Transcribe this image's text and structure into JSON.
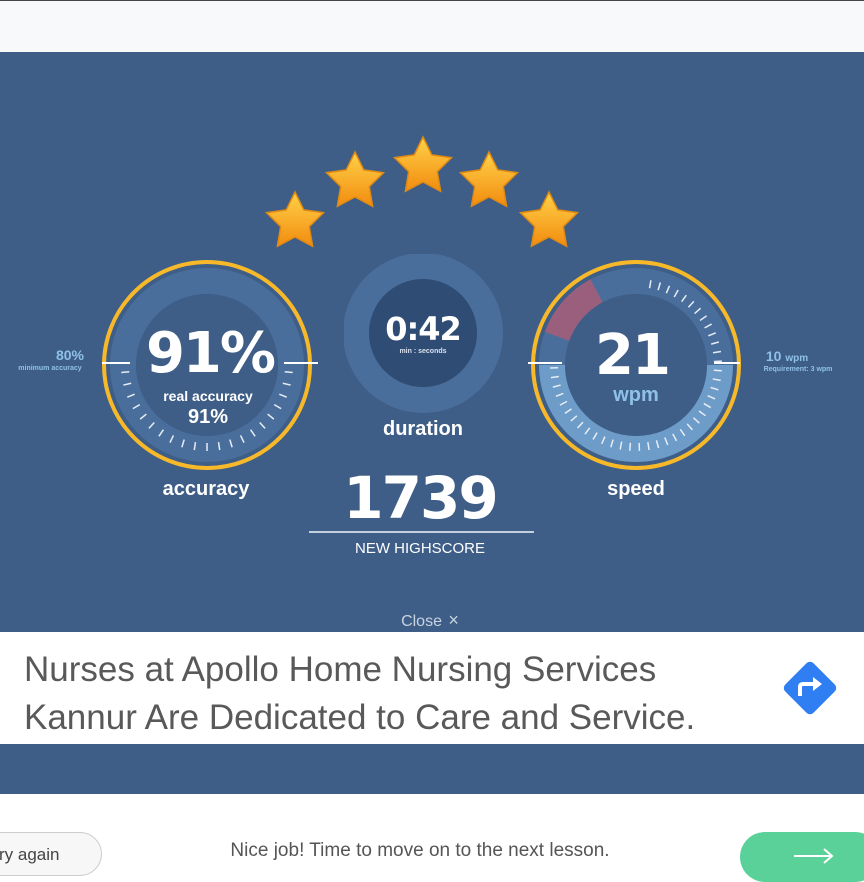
{
  "stats": {
    "stars_earned": 5,
    "stars_total": 5,
    "accuracy": {
      "percent_display": "91%",
      "percent_value": 91,
      "real_accuracy_label": "real accuracy",
      "real_accuracy_value": "91%",
      "label": "accuracy",
      "minimum_value": "80%",
      "minimum_label": "minimum accuracy"
    },
    "duration": {
      "value": "0:42",
      "unit_label": "min : seconds",
      "label": "duration"
    },
    "speed": {
      "value": "21",
      "unit": "wpm",
      "label": "speed",
      "requirement_value": "10",
      "requirement_unit": "wpm",
      "requirement_label": "Requirement: 3 wpm"
    },
    "score": {
      "value": "1739",
      "label": "NEW HIGHSCORE"
    }
  },
  "close_label": "Close",
  "close_icon": "×",
  "ad": {
    "text": "Nurses at Apollo Home Nursing Services Kannur Are Dedicated to Care and Service.",
    "icon": "directions-icon"
  },
  "footer": {
    "try_again_label": "ry again",
    "message": "Nice job! Time to move on to the next lesson.",
    "next_icon": "arrow-right-icon"
  },
  "colors": {
    "panel": "#3e5e87",
    "ring": "#f7b92a",
    "gauge_dark": "#2f4d74",
    "gauge_mid": "#4a6e9b",
    "speed_fill": "#6d9cc9",
    "speed_red": "#9b5f7e",
    "star": "#f6a61b",
    "next_button": "#5bd19a",
    "wpm_text": "#8fc1e8"
  }
}
